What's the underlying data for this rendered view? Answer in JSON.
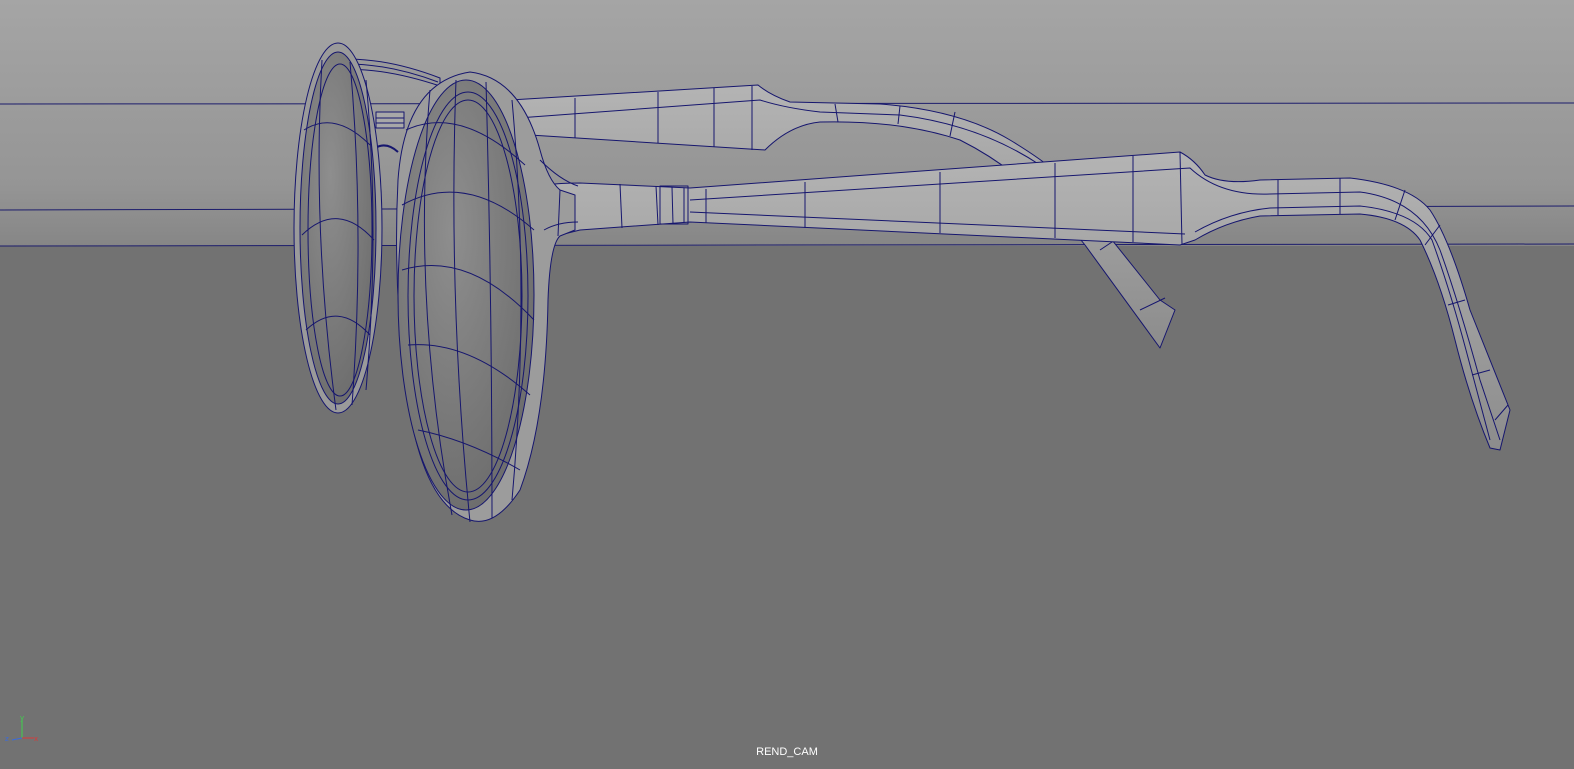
{
  "viewport": {
    "camera_name": "REND_CAM",
    "background_top": "#a2a2a2",
    "background_mid": "#8c8c8c",
    "floor_color": "#727272",
    "wire_color": "#16166e",
    "mesh_color": "#8a8a8a"
  },
  "axis_gizmo": {
    "x_label": "x",
    "y_label": "y",
    "z_label": "z",
    "x_color": "#d83a3a",
    "y_color": "#3fd24c",
    "z_color": "#3a6bdc"
  }
}
